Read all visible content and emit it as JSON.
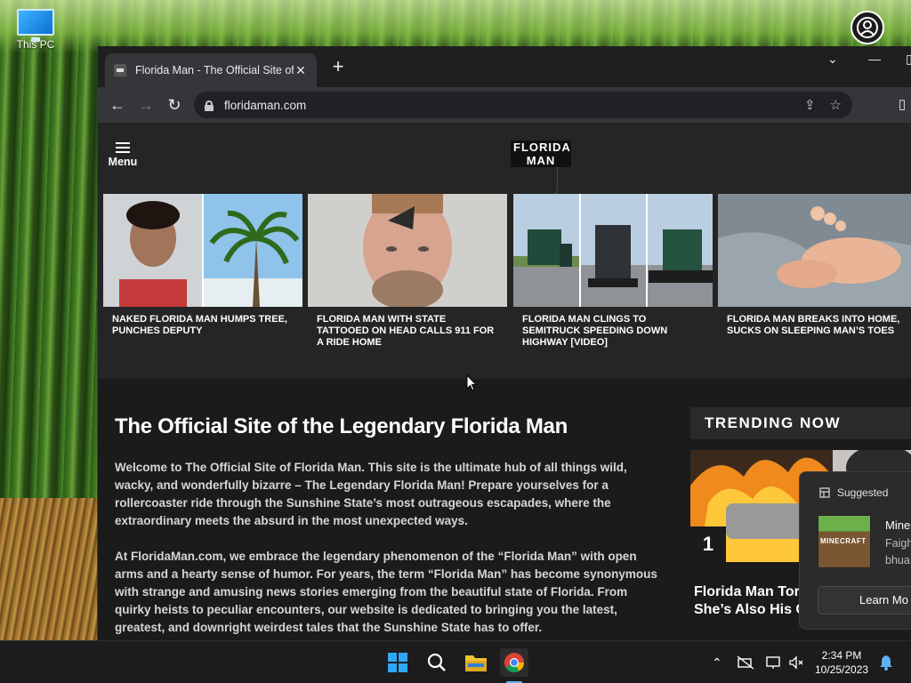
{
  "desktop": {
    "icons": [
      {
        "label": "This PC"
      }
    ]
  },
  "browser": {
    "tab": {
      "title": "Florida Man - The Official Site of",
      "close": "✕"
    },
    "new_tab": "+",
    "window_controls": {
      "tabsearch": "⌄",
      "minimize": "—",
      "maximize": "▯"
    },
    "nav": {
      "back": "←",
      "forward": "→",
      "reload": "↻"
    },
    "url": "floridaman.com",
    "omni_icons": {
      "share": "⇪",
      "star": "☆",
      "sidepanel": "▯"
    }
  },
  "site": {
    "menu_label": "Menu",
    "logo": [
      "FLORIDA",
      "MAN"
    ],
    "carousel": [
      {
        "headline": "NAKED FLORIDA MAN HUMPS TREE, PUNCHES DEPUTY"
      },
      {
        "headline": "FLORIDA MAN WITH STATE TATTOOED ON HEAD CALLS 911 FOR A RIDE HOME"
      },
      {
        "headline": "FLORIDA MAN CLINGS TO SEMITRUCK SPEEDING DOWN HIGHWAY [VIDEO]"
      },
      {
        "headline": "FLORIDA MAN BREAKS INTO HOME, SUCKS ON SLEEPING MAN’S TOES"
      }
    ],
    "article": {
      "title": "The Official Site of the Legendary Florida Man",
      "paragraphs": [
        "Welcome to The Official Site of Florida Man.  This site is the ultimate hub of all things wild, wacky, and wonderfully bizarre – The Legendary Florida Man! Prepare yourselves for a rollercoaster ride through the Sunshine State’s most outrageous escapades, where the extraordinary meets the absurd in the most unexpected ways.",
        "At FloridaMan.com, we embrace the legendary phenomenon of the “Florida Man” with open arms and a hearty sense of humor. For years, the term “Florida Man” has become synonymous with strange and amusing news stories emerging from the beautiful state of Florida. From quirky heists to peculiar encounters, our website is dedicated to bringing you the latest, greatest, and downright weirdest tales that the Sunshine State has to offer."
      ]
    },
    "trending": {
      "heading": "TRENDING NOW",
      "rank": "1",
      "title_line1": "Florida Man Tor",
      "title_line2": "She’s Also His C"
    }
  },
  "suggestion": {
    "header": "Suggested",
    "app_icon_text": "MINECRAFT",
    "line1": "Mine",
    "line2": "Faigh",
    "line3": "bhua",
    "button": "Learn Mo"
  },
  "taskbar": {
    "clock_time": "2:34 PM",
    "clock_date": "10/25/2023",
    "tray_icons": {
      "chevron": "⌃"
    }
  }
}
